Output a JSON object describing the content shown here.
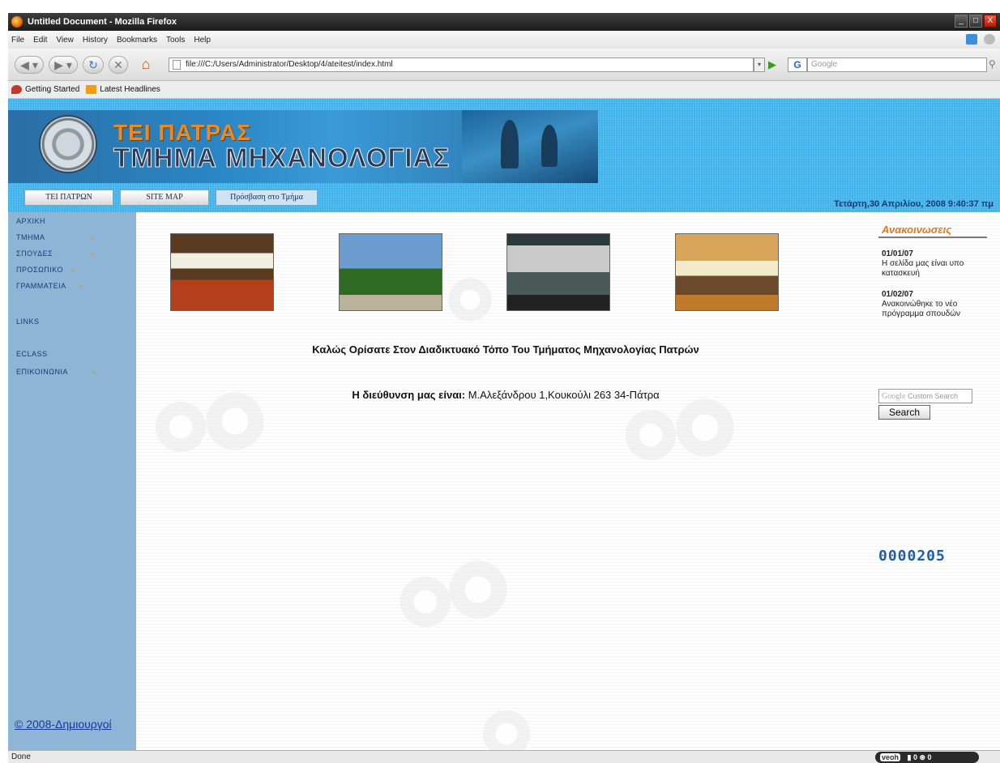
{
  "window": {
    "title": "Untitled Document - Mozilla Firefox",
    "controls": {
      "minimize": "_",
      "maximize": "□",
      "close": "X"
    }
  },
  "menu": [
    "File",
    "Edit",
    "View",
    "History",
    "Bookmarks",
    "Tools",
    "Help"
  ],
  "toolbar": {
    "url": "file:///C:/Users/Administrator/Desktop/4/ateitest/index.html",
    "search_engine": "G",
    "search_placeholder": "Google"
  },
  "bookmarks": [
    "Getting Started",
    "Latest Headlines"
  ],
  "header": {
    "title_line1": "ΤΕΙ ΠΑΤΡΑΣ",
    "title_line2": "ΤΜΗΜΑ ΜΗΧΑΝΟΛΟΓΙΑΣ"
  },
  "topnav": [
    "ΤΕΙ ΠΑΤΡΩΝ",
    "SITE MAP",
    "Πρόσβαση στο Τμήμα"
  ],
  "datetime": "Τετάρτη,30 Απριλίου, 2008 9:40:37 πμ",
  "sidebar": {
    "items": [
      "ΑΡΧΙΚΗ",
      "ΤΜΗΜΑ",
      "ΣΠΟΥΔΕΣ",
      "ΠΡΟΣΩΠΙΚΟ",
      "ΓΡΑΜΜΑΤΕΙΑ",
      "LINKS",
      "ECLASS",
      "ΕΠΙΚΟΙΝΩΝΙΑ"
    ],
    "copyright": "© 2008-Δημιουργοί"
  },
  "main": {
    "welcome": "Καλώς Ορίσατε Στον Διαδικτυακό Τόπο Του Τμήματος Μηχανολογίας Πατρών",
    "address_label": "Η διεύθυνση μας είναι:",
    "address_value": " Μ.Αλεξάνδρου 1,Κουκούλι 263 34-Πάτρα"
  },
  "announcements": {
    "header": "Ανακοινωσεις",
    "items": [
      {
        "date": "01/01/07",
        "text": "Η σελίδα μας είναι υπο κατασκευή"
      },
      {
        "date": "01/02/07",
        "text": "Ανακοινώθηκε το νέο πρόγραμμα σπουδών"
      }
    ]
  },
  "custom_search": {
    "logo": "Google",
    "placeholder": "Custom Search",
    "button": "Search"
  },
  "counter": "0000205",
  "status": {
    "text": "Done",
    "veoh": "veoh",
    "veoh_counts": "▮ 0  ⊛ 0"
  }
}
